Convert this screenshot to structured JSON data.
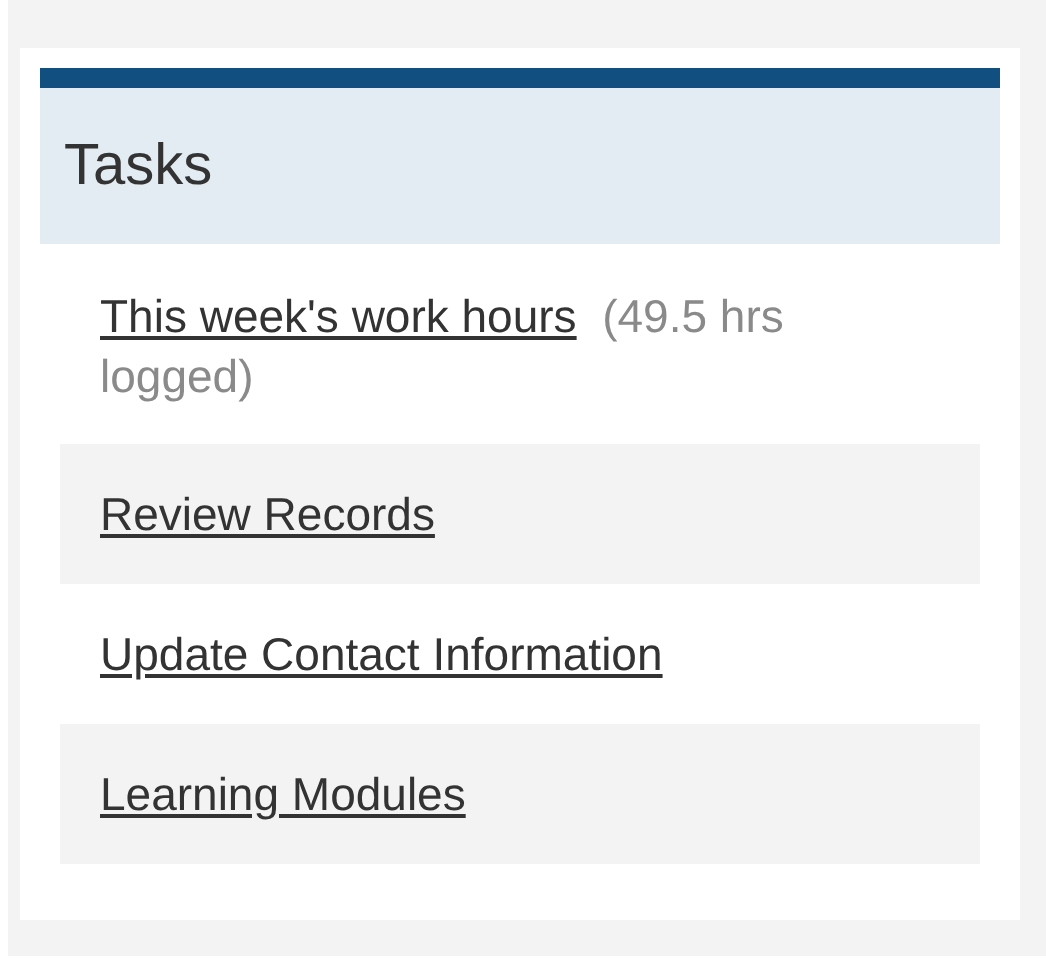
{
  "panel": {
    "title": "Tasks",
    "items": [
      {
        "link": "This week's work hours",
        "note": "(49.5 hrs logged)"
      },
      {
        "link": "Review Records"
      },
      {
        "link": "Update Contact Information"
      },
      {
        "link": "Learning Modules"
      }
    ]
  }
}
